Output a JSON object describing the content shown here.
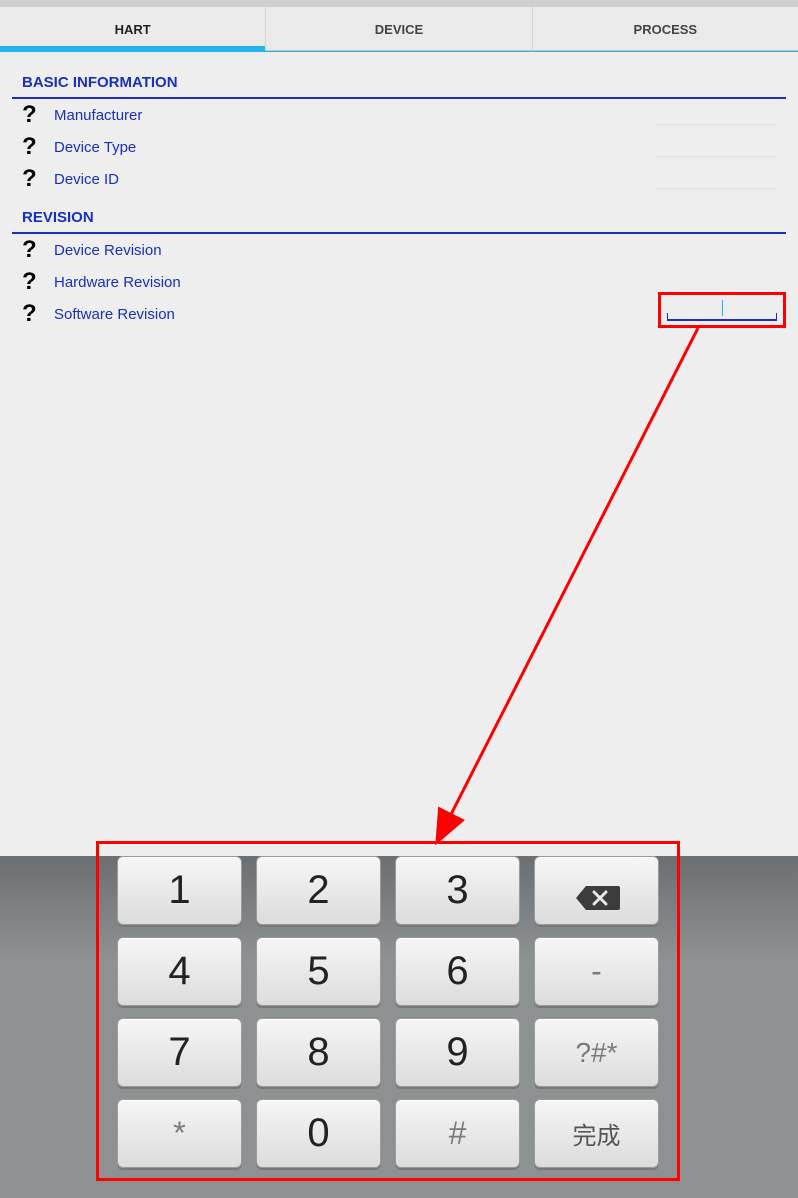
{
  "tabs": {
    "hart": "HART",
    "device": "DEVICE",
    "process": "PROCESS"
  },
  "sections": {
    "basic_info": {
      "title": "BASIC INFORMATION",
      "rows": {
        "manufacturer": "Manufacturer",
        "device_type": "Device Type",
        "device_id": "Device ID"
      }
    },
    "revision": {
      "title": "REVISION",
      "rows": {
        "device_revision": "Device Revision",
        "hardware_revision": "Hardware Revision",
        "software_revision": "Software Revision"
      }
    }
  },
  "input": {
    "software_revision_value": ""
  },
  "keypad": {
    "k1": "1",
    "k2": "2",
    "k3": "3",
    "k4": "4",
    "k5": "5",
    "k6": "6",
    "k7": "7",
    "k8": "8",
    "k9": "9",
    "k0": "0",
    "minus": "-",
    "symbols": "?#*",
    "star": "*",
    "hash": "#",
    "done": "完成"
  }
}
